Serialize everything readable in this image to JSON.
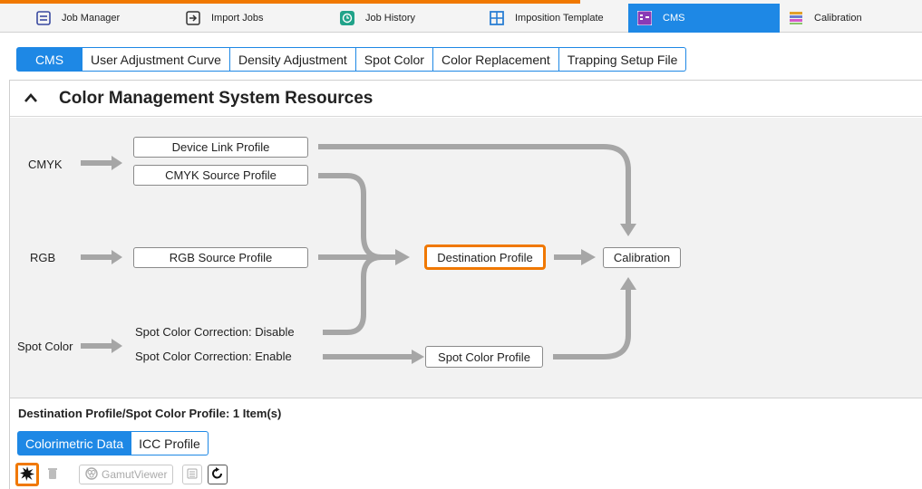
{
  "app_tabs": [
    {
      "label": "Job Manager",
      "icon": "job-manager-icon"
    },
    {
      "label": "Import Jobs",
      "icon": "import-icon"
    },
    {
      "label": "Job History",
      "icon": "history-icon"
    },
    {
      "label": "Imposition Template",
      "icon": "grid-icon"
    },
    {
      "label": "CMS",
      "icon": "cms-icon",
      "active": true
    },
    {
      "label": "Calibration",
      "icon": "calibration-icon"
    }
  ],
  "sub_tabs": [
    "CMS",
    "User Adjustment Curve",
    "Density Adjustment",
    "Spot Color",
    "Color Replacement",
    "Trapping Setup File"
  ],
  "section": {
    "title": "Color Management System Resources"
  },
  "diagram": {
    "inputs": {
      "cmyk": "CMYK",
      "rgb": "RGB",
      "spot": "Spot Color"
    },
    "device_link": "Device Link Profile",
    "cmyk_source": "CMYK Source Profile",
    "rgb_source": "RGB Source Profile",
    "spot_disable": "Spot Color Correction: Disable",
    "spot_enable": "Spot Color Correction: Enable",
    "destination": "Destination Profile",
    "spot_profile": "Spot Color Profile",
    "calibration": "Calibration"
  },
  "bottom": {
    "title": "Destination Profile/Spot Color Profile: 1 Item(s)",
    "tabs": [
      "Colorimetric Data",
      "ICC Profile"
    ],
    "gamut_label": "GamutViewer"
  },
  "colors": {
    "accent": "#1e88e5",
    "highlight": "#f07800",
    "arrow": "#a6a6a6"
  }
}
